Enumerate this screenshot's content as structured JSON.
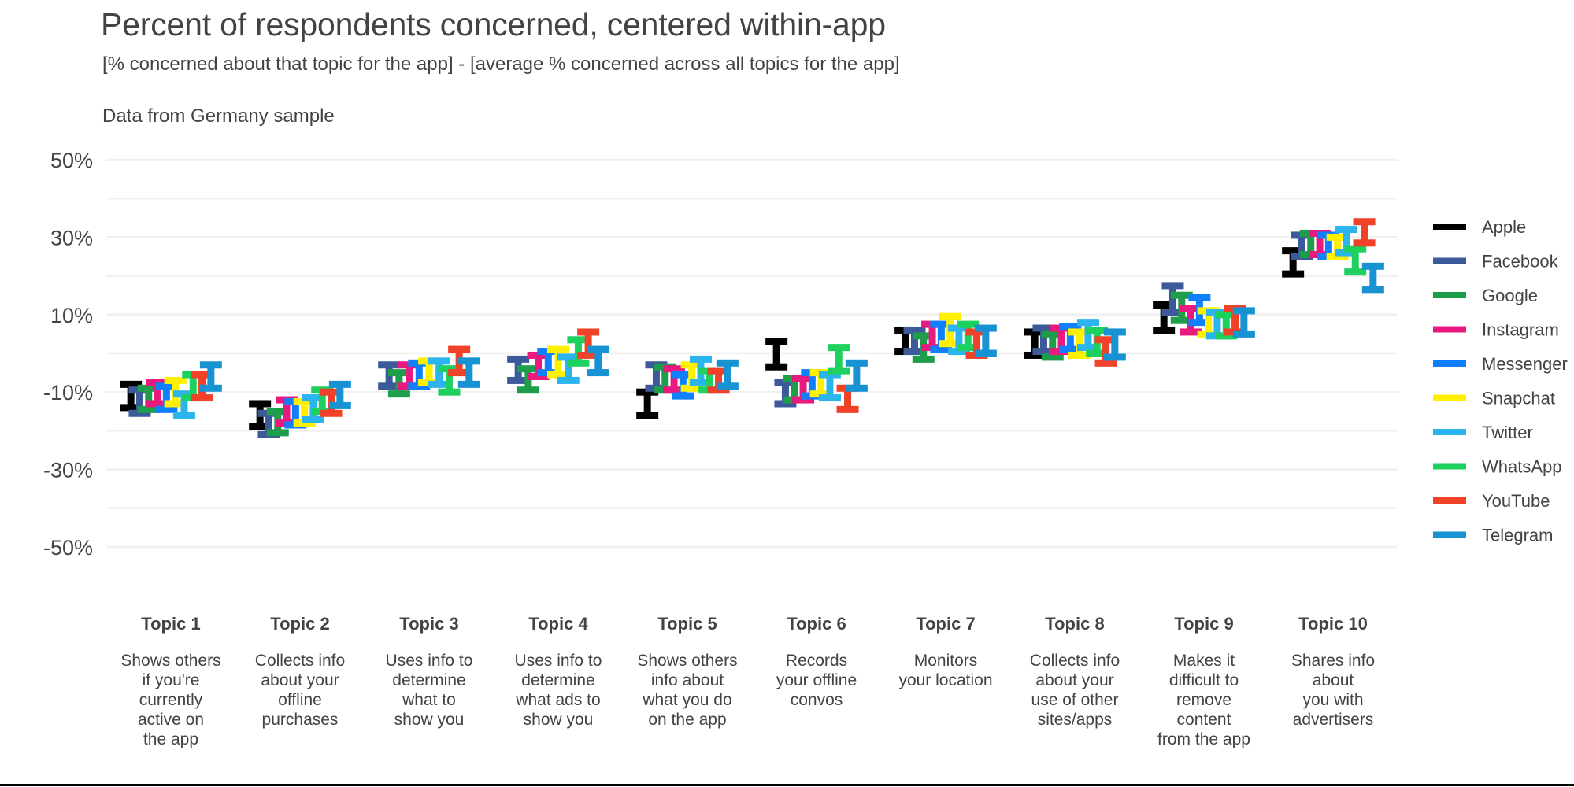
{
  "header": {
    "title": "Percent of respondents concerned, centered within-app",
    "subtitle": "[% concerned about that topic for the app] - [average % concerned across all topics for the app]",
    "note": "Data from Germany sample"
  },
  "colors": {
    "Apple": "#000000",
    "Facebook": "#3c5a99",
    "Google": "#1e9e4a",
    "Instagram": "#e8197f",
    "Messenger": "#0f7ffb",
    "Snapchat": "#fff000",
    "Twitter": "#2cb4ef",
    "WhatsApp": "#1ed05e",
    "YouTube": "#f04229",
    "Telegram": "#1792d2",
    "gridline": "#f0f0f0",
    "text": "#434343",
    "background": "#ffffff"
  },
  "legend": {
    "position": "right",
    "items": [
      {
        "label": "Apple",
        "color": "#000000"
      },
      {
        "label": "Facebook",
        "color": "#3c5a99"
      },
      {
        "label": "Google",
        "color": "#1e9e4a"
      },
      {
        "label": "Instagram",
        "color": "#e8197f"
      },
      {
        "label": "Messenger",
        "color": "#0f7ffb"
      },
      {
        "label": "Snapchat",
        "color": "#fff000"
      },
      {
        "label": "Twitter",
        "color": "#2cb4ef"
      },
      {
        "label": "WhatsApp",
        "color": "#1ed05e"
      },
      {
        "label": "YouTube",
        "color": "#f04229"
      },
      {
        "label": "Telegram",
        "color": "#1792d2"
      }
    ]
  },
  "chart_data": {
    "type": "scatter",
    "title": "Percent of respondents concerned, centered within-app",
    "subtitle": "[% concerned about that topic for the app] - [average % concerned across all topics for the app]",
    "annotation": "Data from Germany sample",
    "xlabel": "",
    "ylabel": "",
    "ylim": [
      -50,
      50
    ],
    "ytick_labels": [
      "50%",
      "30%",
      "10%",
      "-10%",
      "-30%",
      "-50%"
    ],
    "yticks": [
      50,
      30,
      10,
      -10,
      -30,
      -50
    ],
    "minor_gridlines": [
      40,
      20,
      0,
      -20,
      -40
    ],
    "grid": true,
    "error_bar_style": "capped-vertical-interval",
    "categories": [
      {
        "id": "Topic 1",
        "desc": "Shows others if you're currently active on the app"
      },
      {
        "id": "Topic 2",
        "desc": "Collects info about your offline purchases"
      },
      {
        "id": "Topic 3",
        "desc": "Uses info to determine what to show you"
      },
      {
        "id": "Topic 4",
        "desc": "Uses info to determine what ads to show you"
      },
      {
        "id": "Topic 5",
        "desc": "Shows others info about what you do on the app"
      },
      {
        "id": "Topic 6",
        "desc": "Records your offline convos"
      },
      {
        "id": "Topic 7",
        "desc": "Monitors your location"
      },
      {
        "id": "Topic 8",
        "desc": "Collects info about your use of other sites/apps"
      },
      {
        "id": "Topic 9",
        "desc": "Makes it difficult to remove content from the app"
      },
      {
        "id": "Topic 10",
        "desc": "Shares info about you with advertisers"
      }
    ],
    "category_labels": [
      "Topic 1",
      "Topic 2",
      "Topic 3",
      "Topic 4",
      "Topic 5",
      "Topic 6",
      "Topic 7",
      "Topic 8",
      "Topic 9",
      "Topic 10"
    ],
    "category_descriptions": [
      [
        "Shows others",
        "if you're",
        "currently",
        "active on",
        "the app"
      ],
      [
        "Collects info",
        "about your",
        "offline",
        "purchases"
      ],
      [
        "Uses info to",
        "determine",
        "what to",
        "show you"
      ],
      [
        "Uses info to",
        "determine",
        "what ads to",
        "show you"
      ],
      [
        "Shows others",
        "info about",
        "what you do",
        "on the app"
      ],
      [
        "Records",
        "your offline",
        "convos"
      ],
      [
        "Monitors",
        "your location"
      ],
      [
        "Collects info",
        "about your",
        "use of other",
        "sites/apps"
      ],
      [
        "Makes it",
        "difficult to",
        "remove",
        "content",
        "from the app"
      ],
      [
        "Shares info",
        "about",
        "you with",
        "advertisers"
      ]
    ],
    "series": [
      {
        "name": "Apple",
        "color": "#000000",
        "points": [
          {
            "category": "Topic 1",
            "low": -14.0,
            "high": -8.0
          },
          {
            "category": "Topic 2",
            "low": -19.0,
            "high": -13.0
          },
          {
            "category": "Topic 3",
            "low": null,
            "high": null
          },
          {
            "category": "Topic 4",
            "low": null,
            "high": null
          },
          {
            "category": "Topic 5",
            "low": -16.0,
            "high": -10.0
          },
          {
            "category": "Topic 6",
            "low": -3.5,
            "high": 3.0
          },
          {
            "category": "Topic 7",
            "low": 0.5,
            "high": 6.0
          },
          {
            "category": "Topic 8",
            "low": -0.5,
            "high": 5.5
          },
          {
            "category": "Topic 9",
            "low": 6.0,
            "high": 12.5
          },
          {
            "category": "Topic 10",
            "low": 20.5,
            "high": 26.5
          }
        ]
      },
      {
        "name": "Facebook",
        "color": "#3c5a99",
        "points": [
          {
            "category": "Topic 1",
            "low": -15.5,
            "high": -9.5
          },
          {
            "category": "Topic 2",
            "low": -21.0,
            "high": -15.5
          },
          {
            "category": "Topic 3",
            "low": -8.5,
            "high": -3.0
          },
          {
            "category": "Topic 4",
            "low": -7.0,
            "high": -1.5
          },
          {
            "category": "Topic 5",
            "low": -9.0,
            "high": -3.0
          },
          {
            "category": "Topic 6",
            "low": -13.0,
            "high": -7.5
          },
          {
            "category": "Topic 7",
            "low": 0.5,
            "high": 6.0
          },
          {
            "category": "Topic 8",
            "low": 0.5,
            "high": 6.5
          },
          {
            "category": "Topic 9",
            "low": 10.5,
            "high": 17.5
          },
          {
            "category": "Topic 10",
            "low": 25.0,
            "high": 30.5
          }
        ]
      },
      {
        "name": "Google",
        "color": "#1e9e4a",
        "points": [
          {
            "category": "Topic 1",
            "low": -14.5,
            "high": -9.0
          },
          {
            "category": "Topic 2",
            "low": -20.5,
            "high": -15.0
          },
          {
            "category": "Topic 3",
            "low": -10.5,
            "high": -5.0
          },
          {
            "category": "Topic 4",
            "low": -9.5,
            "high": -4.0
          },
          {
            "category": "Topic 5",
            "low": -9.5,
            "high": -3.5
          },
          {
            "category": "Topic 6",
            "low": -12.0,
            "high": -6.5
          },
          {
            "category": "Topic 7",
            "low": -1.5,
            "high": 4.5
          },
          {
            "category": "Topic 8",
            "low": -1.0,
            "high": 5.0
          },
          {
            "category": "Topic 9",
            "low": 8.5,
            "high": 15.0
          },
          {
            "category": "Topic 10",
            "low": 25.5,
            "high": 31.0
          }
        ]
      },
      {
        "name": "Instagram",
        "color": "#e8197f",
        "points": [
          {
            "category": "Topic 1",
            "low": -13.0,
            "high": -7.5
          },
          {
            "category": "Topic 2",
            "low": -18.0,
            "high": -12.0
          },
          {
            "category": "Topic 3",
            "low": -8.5,
            "high": -3.0
          },
          {
            "category": "Topic 4",
            "low": -6.0,
            "high": -0.5
          },
          {
            "category": "Topic 5",
            "low": -9.5,
            "high": -4.0
          },
          {
            "category": "Topic 6",
            "low": -12.0,
            "high": -6.5
          },
          {
            "category": "Topic 7",
            "low": 1.5,
            "high": 7.5
          },
          {
            "category": "Topic 8",
            "low": 0.5,
            "high": 6.5
          },
          {
            "category": "Topic 9",
            "low": 5.5,
            "high": 11.5
          },
          {
            "category": "Topic 10",
            "low": 25.5,
            "high": 31.0
          }
        ]
      },
      {
        "name": "Messenger",
        "color": "#0f7ffb",
        "points": [
          {
            "category": "Topic 1",
            "low": -14.5,
            "high": -8.5
          },
          {
            "category": "Topic 2",
            "low": -18.5,
            "high": -12.5
          },
          {
            "category": "Topic 3",
            "low": -8.5,
            "high": -2.5
          },
          {
            "category": "Topic 4",
            "low": -5.0,
            "high": 0.5
          },
          {
            "category": "Topic 5",
            "low": -11.0,
            "high": -5.5
          },
          {
            "category": "Topic 6",
            "low": -11.0,
            "high": -5.0
          },
          {
            "category": "Topic 7",
            "low": 1.0,
            "high": 7.5
          },
          {
            "category": "Topic 8",
            "low": 1.0,
            "high": 7.0
          },
          {
            "category": "Topic 9",
            "low": 8.0,
            "high": 14.5
          },
          {
            "category": "Topic 10",
            "low": 25.0,
            "high": 30.5
          }
        ]
      },
      {
        "name": "Snapchat",
        "color": "#fff000",
        "points": [
          {
            "category": "Topic 1",
            "low": -13.0,
            "high": -7.0
          },
          {
            "category": "Topic 2",
            "low": -18.0,
            "high": -12.5
          },
          {
            "category": "Topic 3",
            "low": -7.5,
            "high": -2.0
          },
          {
            "category": "Topic 4",
            "low": -5.5,
            "high": 1.0
          },
          {
            "category": "Topic 5",
            "low": -9.0,
            "high": -3.0
          },
          {
            "category": "Topic 6",
            "low": -10.5,
            "high": -5.0
          },
          {
            "category": "Topic 7",
            "low": 2.5,
            "high": 9.5
          },
          {
            "category": "Topic 8",
            "low": -0.5,
            "high": 5.5
          },
          {
            "category": "Topic 9",
            "low": 5.0,
            "high": 11.0
          },
          {
            "category": "Topic 10",
            "low": 25.0,
            "high": 30.0
          }
        ]
      },
      {
        "name": "Twitter",
        "color": "#2cb4ef",
        "points": [
          {
            "category": "Topic 1",
            "low": -16.0,
            "high": -10.5
          },
          {
            "category": "Topic 2",
            "low": -17.0,
            "high": -11.5
          },
          {
            "category": "Topic 3",
            "low": -8.0,
            "high": -2.0
          },
          {
            "category": "Topic 4",
            "low": -7.0,
            "high": -1.0
          },
          {
            "category": "Topic 5",
            "low": -7.5,
            "high": -1.5
          },
          {
            "category": "Topic 6",
            "low": -11.5,
            "high": -5.5
          },
          {
            "category": "Topic 7",
            "low": 0.5,
            "high": 6.5
          },
          {
            "category": "Topic 8",
            "low": 1.5,
            "high": 8.0
          },
          {
            "category": "Topic 9",
            "low": 4.5,
            "high": 10.5
          },
          {
            "category": "Topic 10",
            "low": 26.0,
            "high": 32.0
          }
        ]
      },
      {
        "name": "WhatsApp",
        "color": "#1ed05e",
        "points": [
          {
            "category": "Topic 1",
            "low": -11.5,
            "high": -5.5
          },
          {
            "category": "Topic 2",
            "low": -15.0,
            "high": -9.5
          },
          {
            "category": "Topic 3",
            "low": -10.0,
            "high": -4.0
          },
          {
            "category": "Topic 4",
            "low": -2.5,
            "high": 3.5
          },
          {
            "category": "Topic 5",
            "low": -9.5,
            "high": -4.5
          },
          {
            "category": "Topic 6",
            "low": -4.5,
            "high": 1.5
          },
          {
            "category": "Topic 7",
            "low": 1.5,
            "high": 7.5
          },
          {
            "category": "Topic 8",
            "low": 0.0,
            "high": 6.0
          },
          {
            "category": "Topic 9",
            "low": 4.5,
            "high": 10.0
          },
          {
            "category": "Topic 10",
            "low": 21.0,
            "high": 27.0
          }
        ]
      },
      {
        "name": "YouTube",
        "color": "#f04229",
        "points": [
          {
            "category": "Topic 1",
            "low": -11.5,
            "high": -5.5
          },
          {
            "category": "Topic 2",
            "low": -15.5,
            "high": -10.0
          },
          {
            "category": "Topic 3",
            "low": -5.0,
            "high": 1.0
          },
          {
            "category": "Topic 4",
            "low": -0.5,
            "high": 5.5
          },
          {
            "category": "Topic 5",
            "low": -9.5,
            "high": -4.5
          },
          {
            "category": "Topic 6",
            "low": -14.5,
            "high": -9.0
          },
          {
            "category": "Topic 7",
            "low": -0.5,
            "high": 5.5
          },
          {
            "category": "Topic 8",
            "low": -2.5,
            "high": 3.5
          },
          {
            "category": "Topic 9",
            "low": 5.5,
            "high": 11.5
          },
          {
            "category": "Topic 10",
            "low": 28.5,
            "high": 34.0
          }
        ]
      },
      {
        "name": "Telegram",
        "color": "#1792d2",
        "points": [
          {
            "category": "Topic 1",
            "low": -9.0,
            "high": -3.0
          },
          {
            "category": "Topic 2",
            "low": -13.5,
            "high": -8.0
          },
          {
            "category": "Topic 3",
            "low": -8.0,
            "high": -2.0
          },
          {
            "category": "Topic 4",
            "low": -5.0,
            "high": 1.0
          },
          {
            "category": "Topic 5",
            "low": -8.5,
            "high": -2.5
          },
          {
            "category": "Topic 6",
            "low": -9.0,
            "high": -2.5
          },
          {
            "category": "Topic 7",
            "low": 0.0,
            "high": 6.5
          },
          {
            "category": "Topic 8",
            "low": -1.0,
            "high": 5.5
          },
          {
            "category": "Topic 9",
            "low": 5.0,
            "high": 11.0
          },
          {
            "category": "Topic 10",
            "low": 16.5,
            "high": 22.5
          }
        ]
      }
    ]
  }
}
